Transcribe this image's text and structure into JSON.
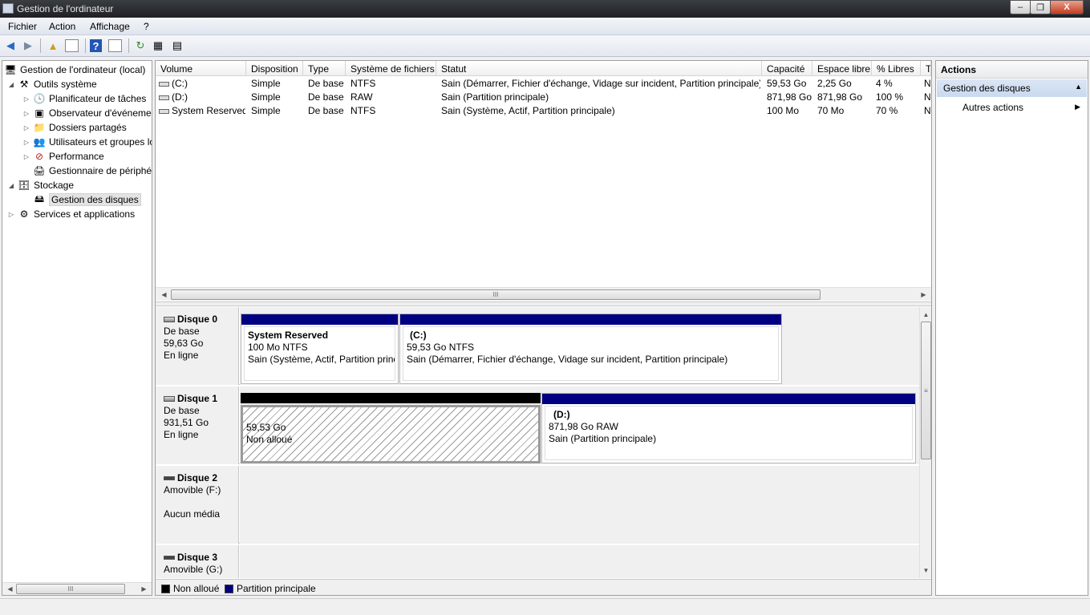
{
  "window": {
    "title": "Gestion de l'ordinateur",
    "min": "–",
    "max": "❐",
    "close": "X"
  },
  "menu": {
    "items": [
      "Fichier",
      "Action",
      "Affichage",
      "?"
    ]
  },
  "tree": {
    "root": "Gestion de l'ordinateur (local)",
    "outils": "Outils système",
    "planificateur": "Planificateur de tâches",
    "observateur": "Observateur d'événements",
    "dossiers": "Dossiers partagés",
    "utilisateurs": "Utilisateurs et groupes locaux",
    "performance": "Performance",
    "gestionnaire": "Gestionnaire de périphériques",
    "stockage": "Stockage",
    "gestion_disques": "Gestion des disques",
    "services": "Services et applications"
  },
  "volumes": {
    "columns": [
      "Volume",
      "Disposition",
      "Type",
      "Système de fichiers",
      "Statut",
      "Capacité",
      "Espace libre",
      "% Libres",
      "Tolérance de panne"
    ],
    "rows": [
      [
        "(C:)",
        "Simple",
        "De base",
        "NTFS",
        "Sain (Démarrer, Fichier d'échange, Vidage sur incident, Partition principale)",
        "59,53 Go",
        "2,25 Go",
        "4 %",
        "N"
      ],
      [
        "(D:)",
        "Simple",
        "De base",
        "RAW",
        "Sain (Partition principale)",
        "871,98 Go",
        "871,98 Go",
        "100 %",
        "N"
      ],
      [
        "System Reserved",
        "Simple",
        "De base",
        "NTFS",
        "Sain (Système, Actif, Partition principale)",
        "100 Mo",
        "70 Mo",
        "70 %",
        "N"
      ]
    ]
  },
  "disks": [
    {
      "name": "Disque 0",
      "type": "De base",
      "size": "59,63 Go",
      "state": "En ligne",
      "partitions": [
        {
          "title": "System Reserved",
          "line2": "100 Mo NTFS",
          "line3": "Sain (Système, Actif, Partition principale)"
        },
        {
          "title": "(C:)",
          "line2": "59,53 Go NTFS",
          "line3": "Sain (Démarrer, Fichier d'échange, Vidage sur incident, Partition principale)"
        }
      ]
    },
    {
      "name": "Disque 1",
      "type": "De base",
      "size": "931,51 Go",
      "state": "En ligne",
      "partitions": [
        {
          "title": "",
          "line2": "59,53 Go",
          "line3": "Non alloué"
        },
        {
          "title": "(D:)",
          "line2": "871,98 Go RAW",
          "line3": "Sain (Partition principale)"
        }
      ]
    },
    {
      "name": "Disque 2",
      "type": "Amovible (F:)",
      "size": "",
      "state": "Aucun média"
    },
    {
      "name": "Disque 3",
      "type": "Amovible (G:)",
      "size": "",
      "state": ""
    }
  ],
  "legend": {
    "unallocated": "Non alloué",
    "primary": "Partition principale",
    "color_unallocated": "#000000",
    "color_primary": "#000080"
  },
  "actions": {
    "title": "Actions",
    "section": "Gestion des disques",
    "item": "Autres actions"
  }
}
